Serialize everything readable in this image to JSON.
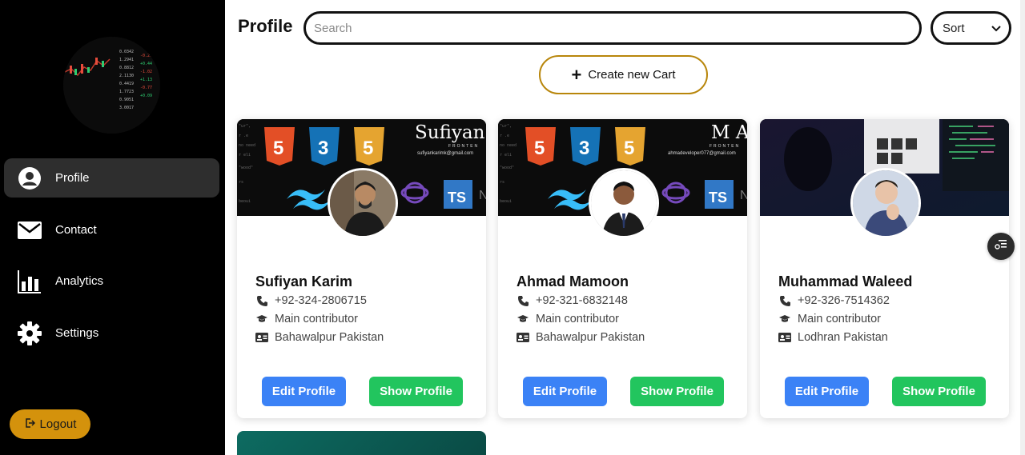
{
  "sidebar": {
    "items": [
      {
        "label": "Profile",
        "icon": "user-circle-icon",
        "active": true
      },
      {
        "label": "Contact",
        "icon": "envelope-icon",
        "active": false
      },
      {
        "label": "Analytics",
        "icon": "bar-chart-icon",
        "active": false
      },
      {
        "label": "Settings",
        "icon": "gear-icon",
        "active": false
      }
    ],
    "logout_label": "Logout"
  },
  "header": {
    "title": "Profile",
    "search_placeholder": "Search",
    "sort_label": "Sort"
  },
  "create_button_label": "Create new Cart",
  "cards": [
    {
      "name": "Sufiyan Karim",
      "phone": "+92-324-2806715",
      "role": "Main contributor",
      "location": "Bahawalpur Pakistan",
      "banner_title": "Sufiyan",
      "banner_subtitle": "FRONTEN",
      "banner_email": "sufiyankarimk@gmail.com",
      "edit_label": "Edit Profile",
      "show_label": "Show Profile"
    },
    {
      "name": "Ahmad Mamoon",
      "phone": "+92-321-6832148",
      "role": "Main contributor",
      "location": "Bahawalpur Pakistan",
      "banner_title": "M A",
      "banner_subtitle": "FRONTEN",
      "banner_email": "ahmadeveloper077@gmail.com",
      "edit_label": "Edit Profile",
      "show_label": "Show Profile"
    },
    {
      "name": "Muhammad Waleed",
      "phone": "+92-326-7514362",
      "role": "Main contributor",
      "location": "Lodhran Pakistan",
      "edit_label": "Edit Profile",
      "show_label": "Show Profile"
    }
  ],
  "colors": {
    "sidebar_bg": "#000000",
    "active_item_bg": "#2e2e2e",
    "logout_bg": "#d4920c",
    "create_border": "#b8860b",
    "edit_btn": "#3b82f6",
    "show_btn": "#22c55e"
  }
}
